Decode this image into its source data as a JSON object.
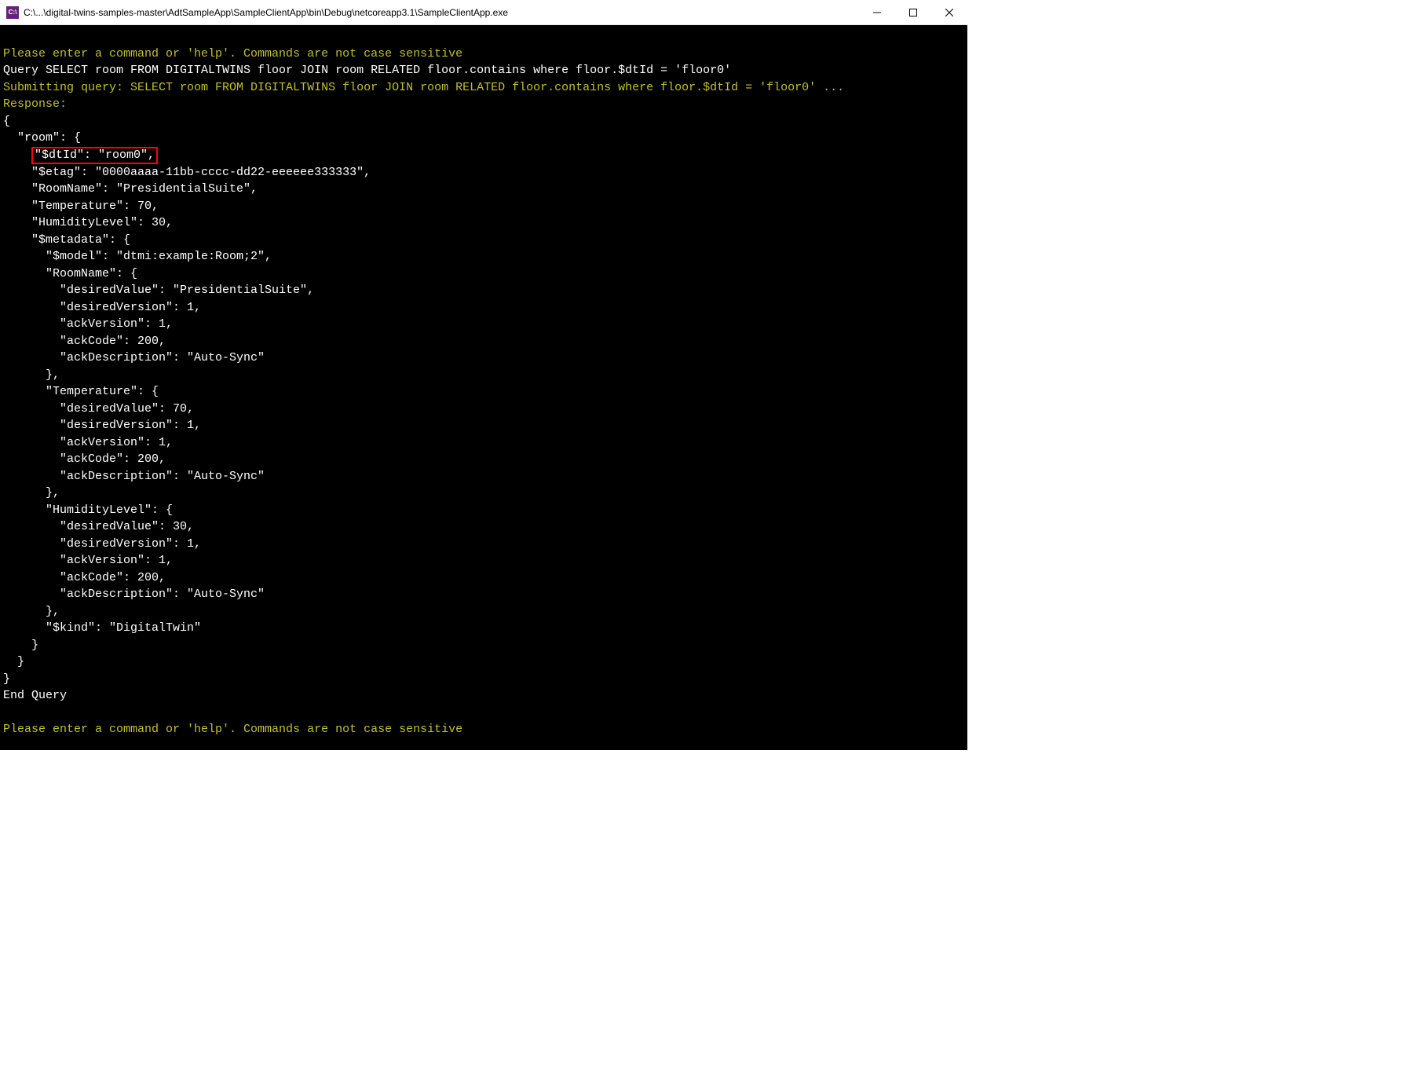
{
  "window": {
    "icon_label": "C:\\",
    "title": "C:\\...\\digital-twins-samples-master\\AdtSampleApp\\SampleClientApp\\bin\\Debug\\netcoreapp3.1\\SampleClientApp.exe"
  },
  "console": {
    "prompt1": "Please enter a command or 'help'. Commands are not case sensitive",
    "query_line": "Query SELECT room FROM DIGITALTWINS floor JOIN room RELATED floor.contains where floor.$dtId = 'floor0'",
    "submitting": "Submitting query: SELECT room FROM DIGITALTWINS floor JOIN room RELATED floor.contains where floor.$dtId = 'floor0' ...",
    "response_label": "Response:",
    "json_open": "{",
    "room_open": "  \"room\": {",
    "dtid_line": "\"$dtId\": \"room0\",",
    "rest": "    \"$etag\": \"0000aaaa-11bb-cccc-dd22-eeeeee333333\",\n    \"RoomName\": \"PresidentialSuite\",\n    \"Temperature\": 70,\n    \"HumidityLevel\": 30,\n    \"$metadata\": {\n      \"$model\": \"dtmi:example:Room;2\",\n      \"RoomName\": {\n        \"desiredValue\": \"PresidentialSuite\",\n        \"desiredVersion\": 1,\n        \"ackVersion\": 1,\n        \"ackCode\": 200,\n        \"ackDescription\": \"Auto-Sync\"\n      },\n      \"Temperature\": {\n        \"desiredValue\": 70,\n        \"desiredVersion\": 1,\n        \"ackVersion\": 1,\n        \"ackCode\": 200,\n        \"ackDescription\": \"Auto-Sync\"\n      },\n      \"HumidityLevel\": {\n        \"desiredValue\": 30,\n        \"desiredVersion\": 1,\n        \"ackVersion\": 1,\n        \"ackCode\": 200,\n        \"ackDescription\": \"Auto-Sync\"\n      },\n      \"$kind\": \"DigitalTwin\"\n    }\n  }\n}",
    "end_query": "End Query",
    "prompt2": "Please enter a command or 'help'. Commands are not case sensitive"
  }
}
